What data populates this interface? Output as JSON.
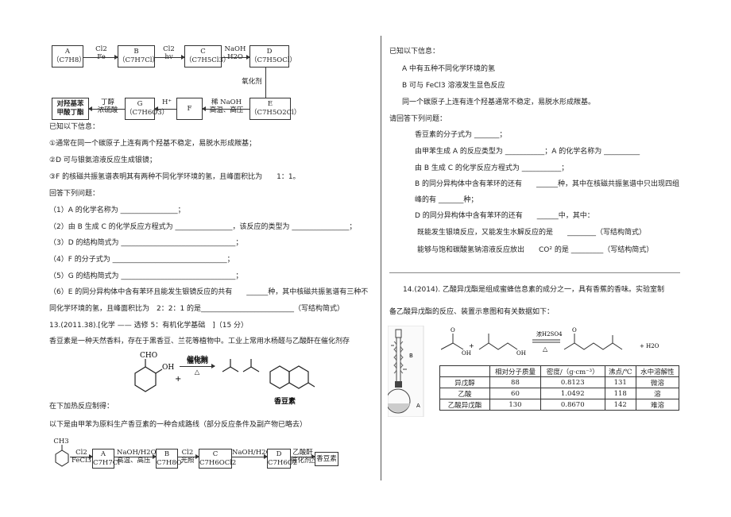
{
  "flow1": {
    "boxes": {
      "A": [
        "A",
        "（C7H8）"
      ],
      "B": [
        "B",
        "（C7H7Cl）"
      ],
      "C": [
        "C",
        "（C7H5Cl3）"
      ],
      "D": [
        "D",
        "（C7H5OCl）"
      ],
      "E": [
        "E",
        "（C7H5O2Cl）"
      ],
      "F": [
        "F"
      ],
      "G": [
        "G",
        "（C7H6O3）"
      ],
      "product": [
        "对羟基苯",
        "甲酸丁酯"
      ]
    },
    "arrows": {
      "ab": [
        "Cl2",
        "Fe"
      ],
      "bc": [
        "Cl2",
        "hv"
      ],
      "cd": [
        "NaOH",
        "H2O"
      ],
      "de": "氧化剂",
      "ef": [
        "稀 NaOH",
        "高温、高压"
      ],
      "fg": "H⁺",
      "gp": [
        "丁醇",
        "浓硫酸"
      ]
    }
  },
  "left": {
    "info_title": "已知以下信息：",
    "info": [
      "①通常在同一个碳原子上连有两个羟基不稳定，易脱水形成羰基；",
      "②D 可与银氨溶液反应生成银镜；",
      "③F 的核磁共振氢谱表明其有两种不同化学环境的氢，且峰面积比为　　1：1。"
    ],
    "questions_title": "回答下列问题：",
    "questions": [
      "（1）A 的化学名称为 ________________；",
      "（2）由 B 生成 C 的化学反应方程式为 ________________，该反应的类型为 ________________；",
      "（3）D 的结构简式为 ________________________________；",
      "（4）F 的分子式为 ________________________________；",
      "（5）G 的结构简式为 ________________________________；",
      "（6）E 的同分异构体中含有苯环且能发生银镜反应的共有　　______种，其中核磁共振氢谱有三种不",
      "同化学环境的氢，且峰面积比为　2：2：1 的是__________________________（写结构简式）"
    ],
    "q13_title": "13.(2011.38).[化学 —— 选修 5：有机化学基础　]（15 分）",
    "q13_text1": "香豆素是一种天然香料，存在于黑香豆、兰花等植物中。工业上常用水杨醛与乙酸酐在催化剂存",
    "reaction": {
      "cho": "CHO",
      "oh": "OH",
      "plus": "+",
      "catalyst": "催化剂",
      "heat": "△",
      "product": "香豆素"
    },
    "q13_text2": "在下加热反应制得：",
    "q13_text3": "以下是由甲苯为原料生产香豆素的一种合成路线（部分反应条件及副产物已略去）",
    "route": {
      "ch3": "CH3",
      "s1": [
        "Cl2",
        "FeCl3"
      ],
      "A": [
        "A",
        "C7H7Cl"
      ],
      "s2": [
        "NaOH/H2O",
        "高温、高压"
      ],
      "B": [
        "B",
        "C7H8O"
      ],
      "s3": [
        "Cl2",
        "光照"
      ],
      "C": [
        "C",
        "C7H6OCl2"
      ],
      "s4": "NaOH/H2O",
      "D": [
        "D",
        "C7H6O2"
      ],
      "s5": [
        "乙酸酐",
        "催化剂△"
      ],
      "end": "香豆素"
    }
  },
  "right": {
    "info_title": "已知以下信息：",
    "info": [
      "A 中有五种不同化学环境的氢",
      "B 可与 FeCl3 溶液发生显色反应",
      "同一个碳原子上连有连个羟基通常不稳定，易脱水形成羰基。"
    ],
    "questions_title": "请回答下列问题：",
    "questions": [
      "香豆素的分子式为 _______；",
      "由甲苯生成 A 的反应类型为 ___________；A 的化学名称为 __________",
      "由 B 生成 C 的化学反应方程式为 ___________；",
      "B 的同分异构体中含有苯环的还有　　______种，其中在核磁共振氢谱中只出现四组",
      "峰的有 _______种；",
      "D 的同分异构体中含有苯环的还有　　______中，其中：",
      "既能发生银境反应，又能发生水解反应的是　　________（写结构简式）",
      "能够与饱和碳酸氢钠溶液反应放出　　CO² 的是 _________（写结构简式）"
    ],
    "q14_line1": "14.(2014).  乙酸异戊酯是组成蜜蜂信息素的成分之一，具有香蕉的香味。实验室制",
    "q14_line2": "备乙酸异戊酯的反应、装置示意图和有关数据如下：",
    "reaction": {
      "oh1": "OH",
      "plus": "+",
      "oh2": "OH",
      "cond": "浓H2SO4",
      "heat": "△",
      "o": "O",
      "water": "+ H2O"
    },
    "apparatus": {
      "a": "A",
      "b": "B"
    },
    "table": {
      "headers": [
        "",
        "相对分子质量",
        "密度/（g·cm⁻³）",
        "沸点/℃",
        "水中溶解性"
      ],
      "rows": [
        [
          "异戊醇",
          "88",
          "0.8123",
          "131",
          "微溶"
        ],
        [
          "乙酸",
          "60",
          "1.0492",
          "118",
          "溶"
        ],
        [
          "乙酸异戊酯",
          "130",
          "0.8670",
          "142",
          "难溶"
        ]
      ]
    }
  }
}
